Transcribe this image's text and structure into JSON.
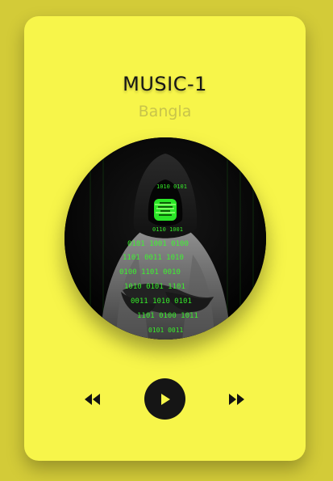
{
  "track": {
    "title": "MUSIC-1",
    "artist": "Bangla"
  },
  "album_art": {
    "icon": "hooded-hacker-image"
  },
  "controls": {
    "previous_icon": "rewind-icon",
    "play_icon": "play-icon",
    "next_icon": "fast-forward-icon"
  },
  "colors": {
    "background": "#d3cb38",
    "card": "#f7f54a",
    "button": "#151515",
    "title": "#161616",
    "subtitle": "#c8c44a",
    "matrix_green": "#38ff2a"
  }
}
